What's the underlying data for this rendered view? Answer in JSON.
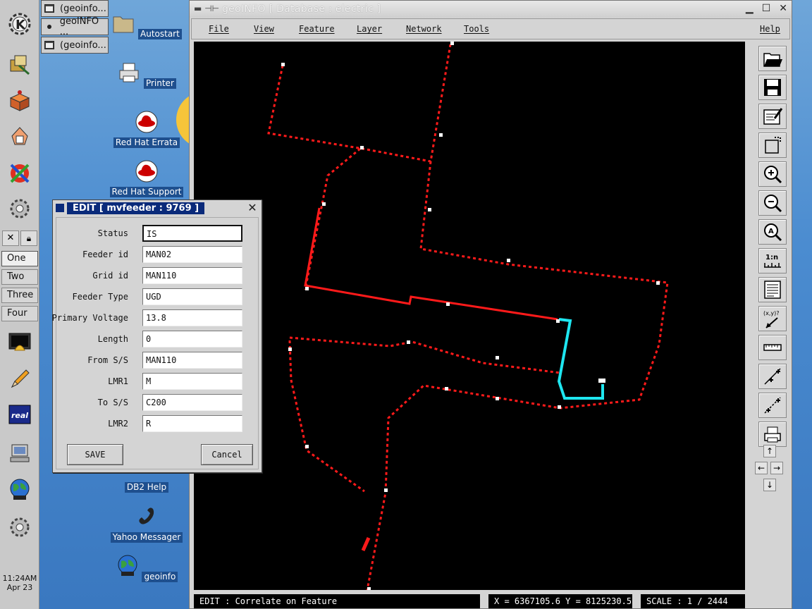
{
  "taskbar": {
    "tasks": [
      "(geoinfo...",
      "geoINFO ...",
      "(geoinfo..."
    ]
  },
  "desktop_icons": [
    "Autostart",
    "Printer",
    "Red Hat Errata",
    "Red Hat Support",
    "DB2 Help",
    "Yahoo Messager",
    "geoinfo"
  ],
  "pager": [
    "One",
    "Two",
    "Three",
    "Four"
  ],
  "clock": {
    "time": "11:24AM",
    "date": "Apr 23"
  },
  "window": {
    "title": "geoINFO  [ Database : electric ]",
    "menu": [
      "File",
      "View",
      "Feature",
      "Layer",
      "Network",
      "Tools"
    ],
    "help": "Help"
  },
  "status": {
    "mode": "EDIT : Correlate on Feature",
    "coords": "X = 6367105.6   Y = 8125230.5",
    "scale": "SCALE :  1 / 2444"
  },
  "dialog": {
    "title": "EDIT  [ mvfeeder : 9769 ]",
    "fields": [
      {
        "label": "Status",
        "value": "IS"
      },
      {
        "label": "Feeder id",
        "value": "MAN02"
      },
      {
        "label": "Grid id",
        "value": "MAN110"
      },
      {
        "label": "Feeder Type",
        "value": "UGD"
      },
      {
        "label": "Primary Voltage",
        "value": "13.8"
      },
      {
        "label": "Length",
        "value": "0"
      },
      {
        "label": "From S/S",
        "value": "MAN110"
      },
      {
        "label": "LMR1",
        "value": "M"
      },
      {
        "label": "To S/S",
        "value": "C200"
      },
      {
        "label": "LMR2",
        "value": "R"
      }
    ],
    "save": "SAVE",
    "cancel": "Cancel"
  },
  "toolbar_icons": [
    "open-folder-icon",
    "save-disk-icon",
    "edit-map-icon",
    "select-rect-icon",
    "zoom-in-icon",
    "zoom-out-icon",
    "zoom-all-icon",
    "scale-1n-icon",
    "attribute-table-icon",
    "xy-query-icon",
    "measure-ruler-icon",
    "move-vertex-icon",
    "snap-vertex-icon",
    "print-icon"
  ],
  "toolbar_labels": {
    "scale": "1:n",
    "xy": "(x,y)?"
  },
  "colors": {
    "network": "#ff1a1a",
    "selected": "#1ee6f0",
    "map_bg": "#000000",
    "dialog_title": "#0a2a7a"
  }
}
